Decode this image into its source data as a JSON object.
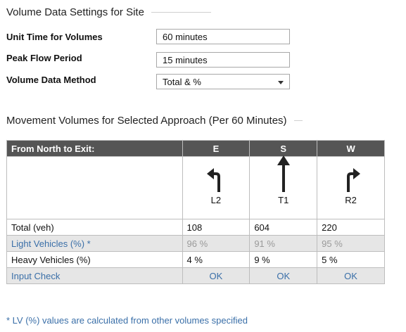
{
  "volume_settings": {
    "title": "Volume Data Settings for Site",
    "fields": [
      {
        "label": "Unit Time for Volumes",
        "value": "60 minutes"
      },
      {
        "label": "Peak Flow Period",
        "value": "15 minutes"
      },
      {
        "label": "Volume Data Method",
        "value": "Total & %"
      }
    ]
  },
  "movement": {
    "title": "Movement Volumes for Selected Approach (Per 60 Minutes)",
    "header_label": "From North to Exit:",
    "columns": [
      {
        "dir": "E",
        "code": "L2",
        "icon": "turn-left-arrow-icon"
      },
      {
        "dir": "S",
        "code": "T1",
        "icon": "straight-arrow-icon"
      },
      {
        "dir": "W",
        "code": "R2",
        "icon": "turn-right-arrow-icon"
      }
    ],
    "rows": {
      "total": {
        "label": "Total (veh)",
        "values": [
          "108",
          "604",
          "220"
        ]
      },
      "lv": {
        "label": "Light Vehicles (%) *",
        "values": [
          "96 %",
          "91 %",
          "95 %"
        ]
      },
      "hv": {
        "label": "Heavy Vehicles (%)",
        "values": [
          "4 %",
          "9 %",
          "5 %"
        ]
      },
      "check": {
        "label": "Input Check",
        "values": [
          "OK",
          "OK",
          "OK"
        ]
      }
    },
    "footnote": "* LV (%) values are calculated from other volumes specified"
  }
}
